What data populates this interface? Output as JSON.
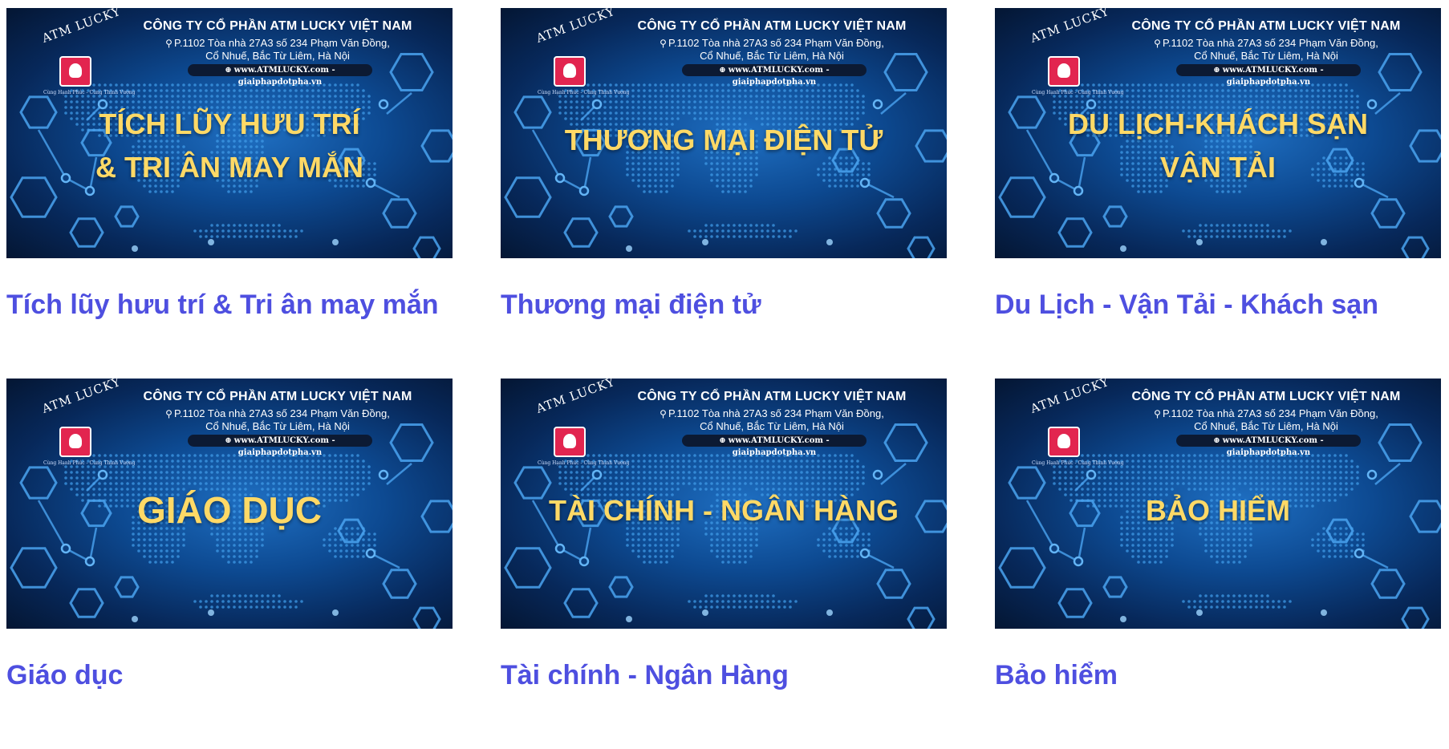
{
  "banner_common": {
    "logo_text": "ATM LUCKY",
    "logo_motto": "Cùng Hạnh Phúc - Cùng Thịnh Vượng",
    "company": "CÔNG TY CỔ PHẦN ATM LUCKY VIỆT NAM",
    "address_line1": "P.1102 Tòa nhà 27A3 số 234 Phạm Văn Đồng,",
    "address_line2": "Cổ Nhuế, Bắc Từ Liêm, Hà Nội",
    "website": "www.ATMLUCKY.com - giaiphapdotpha.vn",
    "pin_icon": "location-pin-icon",
    "globe_icon": "globe-icon"
  },
  "colors": {
    "title": "#4e4fe0",
    "banner_text": "#ffd966",
    "banner_bg": "#0d4a92",
    "logo_badge": "#e2254f"
  },
  "cards": [
    {
      "banner_line1": "TÍCH LŨY HƯU TRÍ",
      "banner_line2": "& TRI ÂN MAY MẮN",
      "title": "Tích lũy hưu trí & Tri ân may mắn"
    },
    {
      "banner_line1": "THƯƠNG MẠI ĐIỆN TỬ",
      "title": "Thương mại điện tử"
    },
    {
      "banner_line1": "DU LỊCH-KHÁCH SẠN",
      "banner_line2": "VẬN TẢI",
      "title": "Du Lịch - Vận Tải - Khách sạn"
    },
    {
      "banner_line1": "GIÁO DỤC",
      "title": "Giáo dục"
    },
    {
      "banner_line1": "TÀI CHÍNH - NGÂN HÀNG",
      "title": "Tài chính - Ngân Hàng"
    },
    {
      "banner_line1": "BẢO HIỂM",
      "title": "Bảo hiểm"
    }
  ]
}
